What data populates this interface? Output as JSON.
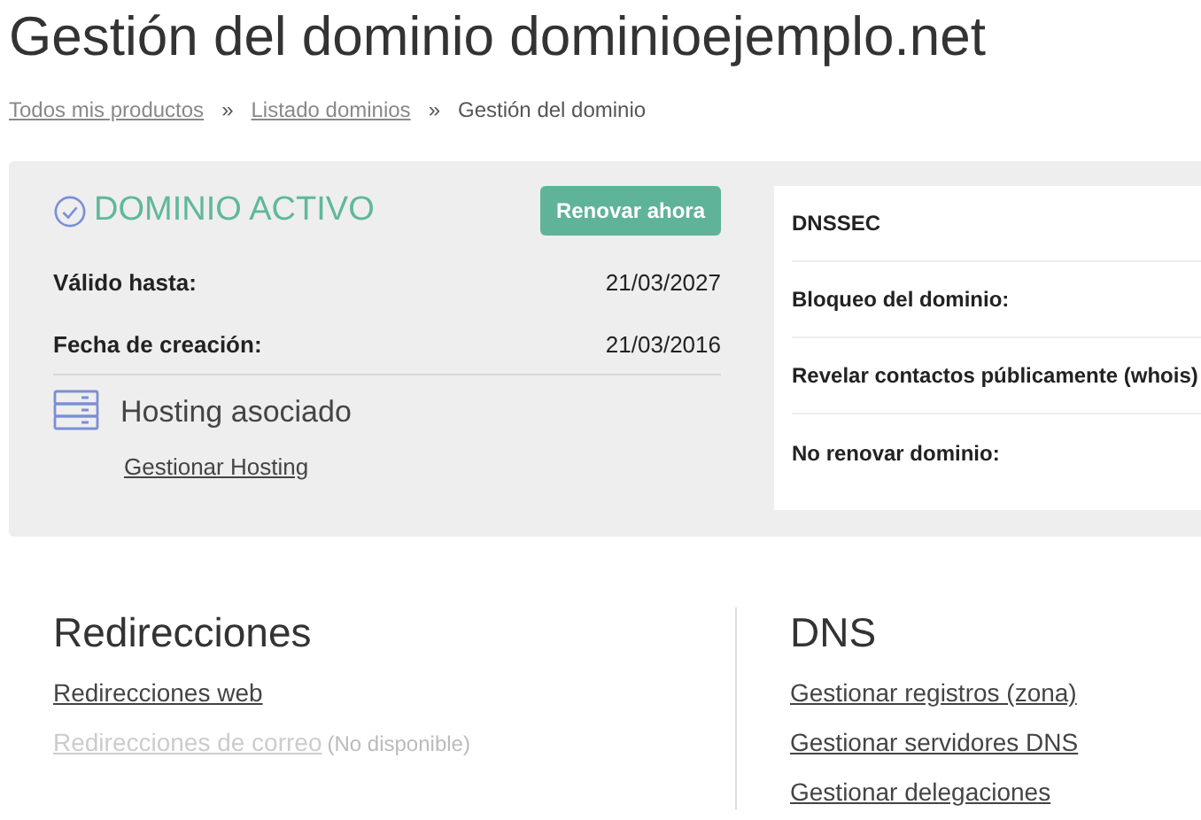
{
  "title": "Gestión del dominio dominioejemplo.net",
  "breadcrumb": [
    {
      "label": "Todos mis productos",
      "kind": "link"
    },
    {
      "label": "»",
      "kind": "separator"
    },
    {
      "label": "Listado dominios",
      "kind": "link"
    },
    {
      "label": "»",
      "kind": "separator"
    },
    {
      "label": "Gestión del dominio",
      "kind": "current"
    }
  ],
  "status": {
    "label": "DOMINIO ACTIVO",
    "button": "Renovar ahora"
  },
  "dates": [
    {
      "label": "Válido hasta:",
      "value": "21/03/2027"
    },
    {
      "label": "Fecha de creación:",
      "value": "21/03/2016"
    }
  ],
  "hosting": {
    "title": "Hosting asociado",
    "link": "Gestionar Hosting"
  },
  "settings": [
    "DNSSEC",
    "Bloqueo del dominio:",
    "Revelar contactos públicamente (whois)",
    "No renovar dominio:"
  ],
  "sections": [
    {
      "title": "Redirecciones",
      "links": [
        {
          "label": "Redirecciones web",
          "disabled": false
        },
        {
          "label": "Redirecciones de correo",
          "disabled": true,
          "note": "(No disponible)"
        }
      ]
    },
    {
      "title": "DNS",
      "links": [
        {
          "label": "Gestionar registros (zona)",
          "disabled": false
        },
        {
          "label": "Gestionar servidores DNS",
          "disabled": false
        },
        {
          "label": "Gestionar delegaciones",
          "disabled": false
        }
      ]
    }
  ]
}
